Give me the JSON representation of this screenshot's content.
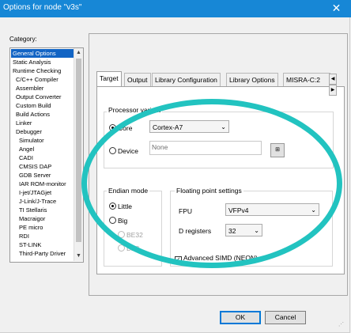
{
  "window": {
    "title": "Options for node \"v3s\"",
    "close_glyph": "✕"
  },
  "category": {
    "label": "Category:",
    "items": [
      {
        "label": "General Options",
        "selected": true
      },
      {
        "label": "Static Analysis"
      },
      {
        "label": "Runtime Checking"
      },
      {
        "label": "C/C++ Compiler"
      },
      {
        "label": "Assembler"
      },
      {
        "label": "Output Converter"
      },
      {
        "label": "Custom Build"
      },
      {
        "label": "Build Actions"
      },
      {
        "label": "Linker"
      },
      {
        "label": "Debugger"
      },
      {
        "label": "Simulator"
      },
      {
        "label": "Angel"
      },
      {
        "label": "CADI"
      },
      {
        "label": "CMSIS DAP"
      },
      {
        "label": "GDB Server"
      },
      {
        "label": "IAR ROM-monitor"
      },
      {
        "label": "I-jet/JTAGjet"
      },
      {
        "label": "J-Link/J-Trace"
      },
      {
        "label": "TI Stellaris"
      },
      {
        "label": "Macraigor"
      },
      {
        "label": "PE micro"
      },
      {
        "label": "RDI"
      },
      {
        "label": "ST-LINK"
      },
      {
        "label": "Third-Party Driver"
      }
    ]
  },
  "tabs": [
    {
      "label": "Target",
      "active": true
    },
    {
      "label": "Output"
    },
    {
      "label": "Library Configuration"
    },
    {
      "label": "Library Options"
    },
    {
      "label": "MISRA-C:2"
    }
  ],
  "processor": {
    "group_title": "Processor variant",
    "core_label": "Core",
    "core_value": "Cortex-A7",
    "device_label": "Device",
    "device_placeholder": "None"
  },
  "endian": {
    "group_title": "Endian mode",
    "little": "Little",
    "big": "Big",
    "be32": "BE32",
    "be8": "BE8"
  },
  "fpu": {
    "group_title": "Floating point settings",
    "fpu_label": "FPU",
    "fpu_value": "VFPv4",
    "dregs_label": "D registers",
    "dregs_value": "32",
    "simd_label": "Advanced SIMD (NEON)",
    "simd_checked": true
  },
  "buttons": {
    "ok": "OK",
    "cancel": "Cancel"
  },
  "colors": {
    "title_bar": "#1787d6",
    "selection": "#1264c4",
    "annotation": "#22c3c0"
  }
}
